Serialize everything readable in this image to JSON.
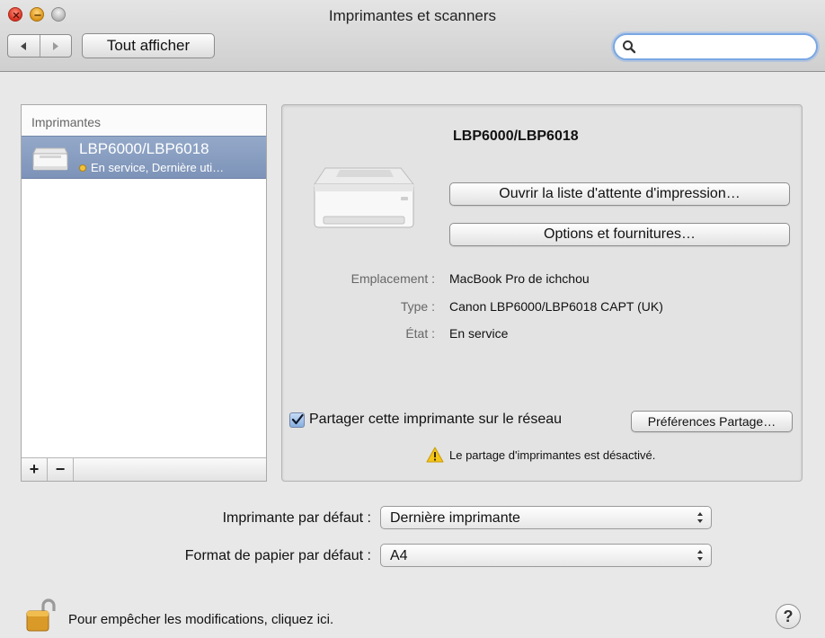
{
  "window": {
    "title": "Imprimantes et scanners",
    "show_all_label": "Tout afficher",
    "search_placeholder": ""
  },
  "printers_list": {
    "header": "Imprimantes",
    "items": [
      {
        "name": "LBP6000/LBP6018",
        "status": "En service, Dernière uti…",
        "status_color": "#f2c23a",
        "selected": true
      }
    ],
    "add_label": "+",
    "remove_label": "−"
  },
  "details": {
    "printer_name": "LBP6000/LBP6018",
    "open_queue_label": "Ouvrir la liste d'attente d'impression…",
    "options_label": "Options et fournitures…",
    "location_label": "Emplacement :",
    "location_value": "MacBook Pro de ichchou",
    "type_label": "Type :",
    "type_value": "Canon LBP6000/LBP6018 CAPT (UK)",
    "state_label": "État :",
    "state_value": "En service",
    "share_checked": true,
    "share_label": "Partager cette imprimante sur le réseau",
    "share_prefs_label": "Préférences Partage…",
    "sharing_warning": "Le partage d'imprimantes est désactivé."
  },
  "defaults": {
    "default_printer_label": "Imprimante par défaut :",
    "default_printer_value": "Dernière imprimante",
    "paper_size_label": "Format de papier par défaut :",
    "paper_size_value": "A4"
  },
  "footer": {
    "lock_text": "Pour empêcher les modifications, cliquez ici.",
    "help_label": "?"
  },
  "colors": {
    "selection": "#8399bd",
    "warning": "#f5c518",
    "search_focus": "#7aa7e3"
  }
}
